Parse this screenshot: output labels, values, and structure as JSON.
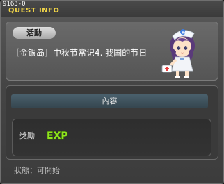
{
  "window": {
    "quest_id": "9163-0",
    "title": "QUEST INFO",
    "close_glyph": "×"
  },
  "quest": {
    "category": "活動",
    "name": "［金银岛］中秋节常识4. 我国的节日",
    "npc": "nurse-npc-portrait"
  },
  "details": {
    "section_label": "內容",
    "reward_label": "獎勵",
    "reward_icon": "exp-icon",
    "reward_icon_text": "EXP"
  },
  "status": {
    "label": "狀態",
    "separator": "：",
    "value": "可開始"
  },
  "colors": {
    "title_yellow": "#f0d448",
    "exp_green": "#8fe31e",
    "content_bar": "#3f525c"
  }
}
